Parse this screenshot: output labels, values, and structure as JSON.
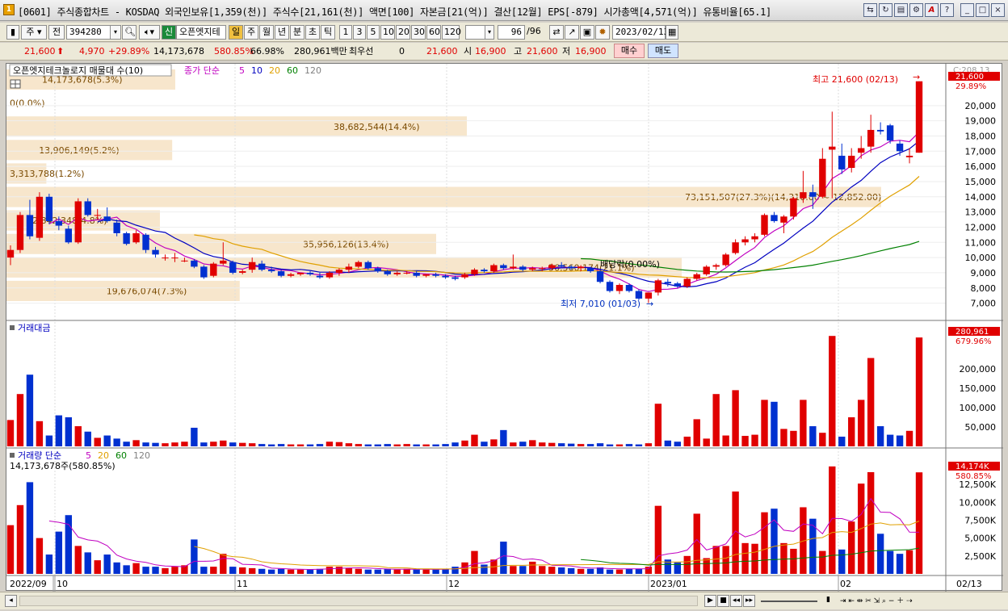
{
  "window": {
    "title": "[0601] 주식종합차트 - KOSDAQ 외국인보유[1,359(천)] 주식수[21,161(천)] 액면[100] 자본금[21(억)] 결산[12월] EPS[-879] 시가총액[4,571(억)] 유통비율[65.1]",
    "app_icon": "1"
  },
  "toolbar": {
    "period_select": "주",
    "prev_label": "전",
    "code": "394280",
    "stock_badge": "신",
    "stock_name": "오픈엣지테",
    "periods": [
      "일",
      "주",
      "월",
      "년",
      "분",
      "초",
      "틱"
    ],
    "active_period": "일",
    "intervals": [
      "1",
      "3",
      "5",
      "10",
      "20",
      "30",
      "60",
      "120"
    ],
    "count": "96",
    "count_total": "/96",
    "date": "2023/02/13"
  },
  "quote": {
    "price": "21,600",
    "change": "4,970",
    "change_pct": "+29.89%",
    "volume": "14,173,678",
    "vol_ratio": "580.85%",
    "ratio2": "66.98%",
    "amount": "280,961백만",
    "priority_label": "최우선",
    "priority_val": "0",
    "bid": "21,600",
    "open_label": "시",
    "open": "16,900",
    "high_label": "고",
    "high": "21,600",
    "low_label": "저",
    "low": "16,900",
    "buy_label": "매수",
    "sell_label": "매도"
  },
  "price_panel": {
    "legend_name": "오픈엣지테크놀로지 매물대 수(10)",
    "ma_title": "종가 단순",
    "ma_periods": [
      "5",
      "10",
      "20",
      "60",
      "120"
    ],
    "ma_colors": [
      "#c000c0",
      "#0000c0",
      "#e0a000",
      "#008000",
      "#808080"
    ],
    "axis_top_label": "C:208.13",
    "current_price_tag": "21,600",
    "current_pct_tag": "29.89%",
    "y_ticks": [
      "20,000",
      "19,000",
      "18,000",
      "17,000",
      "16,000",
      "15,000",
      "14,000",
      "13,000",
      "12,000",
      "11,000",
      "10,000",
      "9,000",
      "8,000",
      "7,000"
    ],
    "high_annotation": "최고 21,600 (02/13)",
    "low_annotation": "최저 7,010 (01/03)",
    "dividend_label": "배당락(0.00%)",
    "volume_profile": [
      {
        "label": "14,173,678(5.3%)",
        "ratio": 0.055
      },
      {
        "label": "0(0.0%)",
        "ratio": 0.0
      },
      {
        "label": "38,682,544(14.4%)",
        "ratio": 0.15
      },
      {
        "label": "13,906,149(5.2%)",
        "ratio": 0.054
      },
      {
        "label": "3,313,788(1.2%)",
        "ratio": 0.013
      },
      {
        "label": "73,151,507(27.3%)(14,310.00 ~ 12,852.00)",
        "ratio": 0.285
      },
      {
        "label": "12,842,348(4.8%)",
        "ratio": 0.05
      },
      {
        "label": "35,956,126(13.4%)",
        "ratio": 0.14
      },
      {
        "label": "56,560,174(21.1%)",
        "ratio": 0.22
      },
      {
        "label": "19,676,074(7.3%)",
        "ratio": 0.076
      }
    ]
  },
  "amount_panel": {
    "title": "거래대금",
    "current_tag": "280,961",
    "pct_tag": "679.96%",
    "y_ticks": [
      "200,000",
      "150,000",
      "100,000",
      "50,000"
    ]
  },
  "volume_panel": {
    "title": "거래량 단순",
    "ma_periods": [
      "5",
      "20",
      "60",
      "120"
    ],
    "current_info": "14,173,678주(580.85%)",
    "current_tag": "14,174K",
    "pct_tag": "580.85%",
    "y_ticks": [
      "15,000K",
      "12,500K",
      "10,000K",
      "7,500K",
      "5,000K",
      "2,500K"
    ]
  },
  "x_axis": {
    "labels": [
      "2022/09",
      "10",
      "11",
      "12",
      "2023/01",
      "02"
    ],
    "right_label": "02/13"
  },
  "chart_data": {
    "type": "candlestick",
    "ylim": [
      6500,
      21000
    ],
    "candles": [
      [
        10000,
        10800,
        9500,
        10500
      ],
      [
        10500,
        13000,
        10300,
        12800
      ],
      [
        12800,
        13800,
        11200,
        11400
      ],
      [
        11300,
        14300,
        11100,
        14000
      ],
      [
        14000,
        14200,
        12200,
        12400
      ],
      [
        12400,
        12700,
        11800,
        12100
      ],
      [
        11900,
        12100,
        10900,
        11000
      ],
      [
        11000,
        13900,
        10900,
        13700
      ],
      [
        13700,
        13900,
        12700,
        12800
      ],
      [
        12800,
        13200,
        12500,
        12800
      ],
      [
        12700,
        13300,
        12300,
        12400
      ],
      [
        12300,
        12500,
        11400,
        11600
      ],
      [
        11600,
        11700,
        10800,
        10900
      ],
      [
        11000,
        11800,
        10900,
        11600
      ],
      [
        11500,
        11600,
        10300,
        10500
      ],
      [
        10500,
        10700,
        10000,
        10200
      ],
      [
        10000,
        10200,
        9800,
        10000
      ],
      [
        10000,
        10300,
        9700,
        10000
      ],
      [
        9800,
        10000,
        9700,
        9800
      ],
      [
        9800,
        9900,
        9300,
        9400
      ],
      [
        9400,
        9500,
        8600,
        8700
      ],
      [
        8800,
        9700,
        8700,
        9600
      ],
      [
        9600,
        11000,
        9500,
        9800
      ],
      [
        9700,
        9800,
        8900,
        9000
      ],
      [
        9000,
        9200,
        8900,
        9100
      ],
      [
        9200,
        10000,
        9000,
        9700
      ],
      [
        9600,
        9800,
        9100,
        9200
      ],
      [
        9200,
        9400,
        9000,
        9100
      ],
      [
        9100,
        9200,
        8700,
        8800
      ],
      [
        8800,
        9000,
        8700,
        8900
      ],
      [
        8900,
        9000,
        8800,
        9000
      ],
      [
        9000,
        9100,
        8800,
        8900
      ],
      [
        8800,
        9000,
        8600,
        8700
      ],
      [
        8700,
        9100,
        8600,
        9000
      ],
      [
        9000,
        9300,
        8800,
        9200
      ],
      [
        9200,
        9600,
        9000,
        9400
      ],
      [
        9400,
        9800,
        9300,
        9700
      ],
      [
        9700,
        9800,
        9200,
        9300
      ],
      [
        9300,
        9400,
        9000,
        9100
      ],
      [
        9100,
        9200,
        8800,
        8900
      ],
      [
        8900,
        9100,
        8800,
        9000
      ],
      [
        9000,
        9100,
        8900,
        9000
      ],
      [
        9000,
        9100,
        8700,
        8800
      ],
      [
        8800,
        8900,
        8700,
        8900
      ],
      [
        8900,
        9000,
        8700,
        8800
      ],
      [
        8800,
        8900,
        8600,
        8700
      ],
      [
        8700,
        8800,
        8500,
        8600
      ],
      [
        8700,
        9000,
        8600,
        8900
      ],
      [
        8900,
        9300,
        8800,
        9200
      ],
      [
        9200,
        9300,
        9000,
        9100
      ],
      [
        9100,
        9600,
        9000,
        9500
      ],
      [
        9500,
        9600,
        9200,
        9300
      ],
      [
        9300,
        10200,
        9200,
        9400
      ],
      [
        9400,
        9500,
        9100,
        9200
      ],
      [
        9200,
        9400,
        9100,
        9300
      ],
      [
        9300,
        9400,
        9100,
        9300
      ],
      [
        9300,
        9600,
        9200,
        9500
      ],
      [
        9500,
        9700,
        9300,
        9400
      ],
      [
        9400,
        9500,
        9200,
        9300
      ],
      [
        9300,
        9500,
        9100,
        9400
      ],
      [
        9300,
        9400,
        9000,
        9100
      ],
      [
        9100,
        9200,
        8300,
        8400
      ],
      [
        8400,
        8500,
        7700,
        7800
      ],
      [
        7800,
        8300,
        7600,
        8200
      ],
      [
        8200,
        8300,
        7700,
        7800
      ],
      [
        7800,
        7900,
        7200,
        7300
      ],
      [
        7300,
        7700,
        7010,
        7700
      ],
      [
        7700,
        8600,
        7500,
        8500
      ],
      [
        8400,
        8600,
        8100,
        8300
      ],
      [
        8300,
        8400,
        8000,
        8100
      ],
      [
        8100,
        8700,
        8000,
        8600
      ],
      [
        8600,
        9000,
        8500,
        8900
      ],
      [
        8900,
        9500,
        8800,
        9400
      ],
      [
        9400,
        9600,
        9200,
        9500
      ],
      [
        9500,
        10300,
        9400,
        10200
      ],
      [
        10300,
        11200,
        10200,
        11000
      ],
      [
        11000,
        11400,
        10800,
        11200
      ],
      [
        11200,
        11600,
        11000,
        11400
      ],
      [
        11500,
        12900,
        11400,
        12800
      ],
      [
        12800,
        13000,
        12300,
        12400
      ],
      [
        12300,
        12800,
        11600,
        12700
      ],
      [
        12700,
        14000,
        12500,
        13900
      ],
      [
        13900,
        15700,
        13600,
        14300
      ],
      [
        14300,
        14800,
        13200,
        14000
      ],
      [
        14000,
        17200,
        13900,
        16500
      ],
      [
        17100,
        19600,
        13900,
        17300
      ],
      [
        16700,
        17500,
        15500,
        15800
      ],
      [
        15900,
        17200,
        15600,
        16700
      ],
      [
        16900,
        18000,
        16500,
        17200
      ],
      [
        17300,
        19400,
        16900,
        18400
      ],
      [
        18400,
        18900,
        18100,
        18300
      ],
      [
        18700,
        18800,
        17500,
        17700
      ],
      [
        17500,
        17700,
        16700,
        17000
      ],
      [
        16600,
        17200,
        16200,
        16700
      ],
      [
        16900,
        21600,
        16900,
        21600
      ]
    ],
    "amount_millions": [
      68000,
      135000,
      185000,
      65000,
      28000,
      80000,
      75000,
      52000,
      38000,
      22000,
      28000,
      20000,
      12000,
      16000,
      10000,
      9000,
      8000,
      10000,
      12000,
      48000,
      10000,
      12000,
      15000,
      10000,
      9000,
      8000,
      6000,
      5000,
      6000,
      5000,
      5000,
      5000,
      6000,
      12000,
      11000,
      8000,
      6000,
      5000,
      5000,
      6000,
      5000,
      6000,
      5000,
      5000,
      5000,
      6000,
      10000,
      15000,
      30000,
      12000,
      18000,
      42000,
      10000,
      12000,
      16000,
      10000,
      9000,
      8000,
      7000,
      6000,
      6000,
      8000,
      5000,
      5000,
      6000,
      5000,
      8000,
      110000,
      15000,
      12000,
      25000,
      70000,
      20000,
      135000,
      28000,
      145000,
      27000,
      30000,
      120000,
      115000,
      45000,
      40000,
      120000,
      52000,
      35000,
      285000,
      25000,
      75000,
      120000,
      228000,
      52000,
      30000,
      28000,
      40000,
      281000,
      6000
    ],
    "volume_thousands": [
      6800,
      9600,
      12800,
      5000,
      2700,
      5900,
      8200,
      3900,
      3000,
      1900,
      2700,
      1600,
      1200,
      1500,
      1000,
      1000,
      800,
      1000,
      1200,
      4800,
      1000,
      1000,
      2800,
      1000,
      900,
      800,
      700,
      600,
      700,
      600,
      600,
      600,
      700,
      1000,
      1000,
      800,
      700,
      600,
      600,
      700,
      600,
      700,
      600,
      600,
      600,
      700,
      1000,
      1600,
      3200,
      1300,
      2000,
      4500,
      1100,
      1100,
      1700,
      1100,
      1000,
      900,
      800,
      700,
      700,
      900,
      600,
      600,
      700,
      700,
      1000,
      9500,
      2000,
      1600,
      2500,
      8400,
      2200,
      3900,
      3900,
      11500,
      4300,
      4200,
      8600,
      9100,
      4300,
      3500,
      9300,
      7700,
      3200,
      15000,
      3400,
      7300,
      12600,
      14200,
      5600,
      3200,
      2800,
      3300,
      14174,
      700
    ]
  }
}
